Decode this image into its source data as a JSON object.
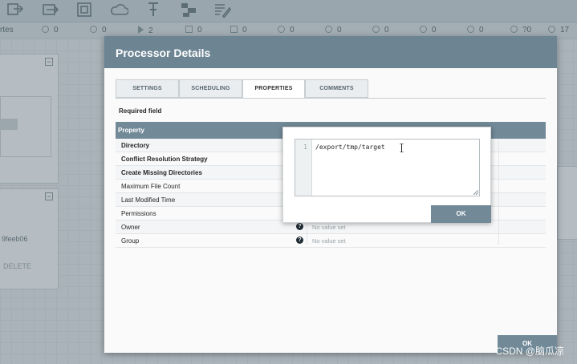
{
  "toolbar": {
    "icons": [
      "upload-template-icon",
      "input-port-icon",
      "process-group-icon",
      "remote-process-group-icon",
      "funnel-icon",
      "template-icon",
      "label-icon"
    ]
  },
  "statusbar": {
    "partial_label": "rtes",
    "counts": [
      "0",
      "0",
      "2",
      "0",
      "0",
      "0",
      "0",
      "0",
      "0",
      "0",
      "?0",
      "17"
    ]
  },
  "background": {
    "processor_id_fragment": "9feeb06",
    "button_fragment": "DELETE"
  },
  "dialog": {
    "title": "Processor Details",
    "tabs": [
      "SETTINGS",
      "SCHEDULING",
      "PROPERTIES",
      "COMMENTS"
    ],
    "required_field": "Required field",
    "property_header": "Property",
    "properties": [
      {
        "name": "Directory",
        "required": true,
        "value": ""
      },
      {
        "name": "Conflict Resolution Strategy",
        "required": true,
        "value": ""
      },
      {
        "name": "Create Missing Directories",
        "required": true,
        "value": ""
      },
      {
        "name": "Maximum File Count",
        "required": false,
        "value": ""
      },
      {
        "name": "Last Modified Time",
        "required": false,
        "value": ""
      },
      {
        "name": "Permissions",
        "required": false,
        "value": ""
      },
      {
        "name": "Owner",
        "required": false,
        "value": "No value set"
      },
      {
        "name": "Group",
        "required": false,
        "value": "No value set"
      }
    ],
    "ok_label": "OK"
  },
  "editor": {
    "line_number": "1",
    "value": "/export/tmp/target",
    "ok_label": "OK"
  },
  "watermark": "CSDN @脑瓜凉"
}
